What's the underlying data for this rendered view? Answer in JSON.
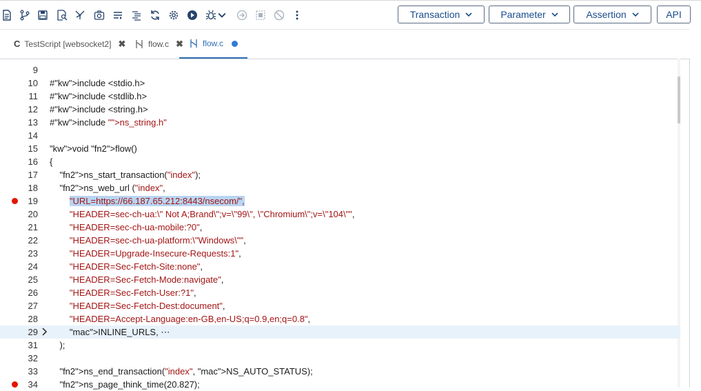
{
  "toolbar": {
    "transaction_label": "Transaction",
    "parameter_label": "Parameter",
    "assertion_label": "Assertion",
    "api_label": "API",
    "icons": [
      "document-icon",
      "branch-icon",
      "save-icon",
      "search-doc-icon",
      "network-icon",
      "camera-icon",
      "list-icon",
      "list-indent-icon",
      "refresh-icon",
      "gear-icon",
      "play-icon",
      "debug-icon",
      "forward-icon",
      "screen-icon",
      "block-icon",
      "more-icon"
    ]
  },
  "tabs": [
    {
      "label": "TestScript [websocket2]",
      "icon": "c-icon",
      "close": "✖"
    },
    {
      "label": "flow.c",
      "icon": "flow-icon",
      "close": "✖"
    },
    {
      "label": "flow.c",
      "icon": "flow-icon",
      "modified": true
    }
  ],
  "editor": {
    "lines": [
      {
        "n": "9",
        "code": ""
      },
      {
        "n": "10",
        "code": "#include <stdio.h>"
      },
      {
        "n": "11",
        "code": "#include <stdlib.h>"
      },
      {
        "n": "12",
        "code": "#include <string.h>"
      },
      {
        "n": "13",
        "code": "#include \"ns_string.h\""
      },
      {
        "n": "14",
        "code": ""
      },
      {
        "n": "15",
        "code": "void flow()"
      },
      {
        "n": "16",
        "code": "{"
      },
      {
        "n": "17",
        "code": "    ns_start_transaction(\"index\");"
      },
      {
        "n": "18",
        "code": "    ns_web_url (\"index\","
      },
      {
        "n": "19",
        "code": "        \"URL=https://66.187.65.212:8443/nsecom/\","
      },
      {
        "n": "20",
        "code": "        \"HEADER=sec-ch-ua:\\\" Not A;Brand\\\";v=\\\"99\\\", \\\"Chromium\\\";v=\\\"104\\\"\","
      },
      {
        "n": "21",
        "code": "        \"HEADER=sec-ch-ua-mobile:?0\","
      },
      {
        "n": "22",
        "code": "        \"HEADER=sec-ch-ua-platform:\\\"Windows\\\"\","
      },
      {
        "n": "23",
        "code": "        \"HEADER=Upgrade-Insecure-Requests:1\","
      },
      {
        "n": "24",
        "code": "        \"HEADER=Sec-Fetch-Site:none\","
      },
      {
        "n": "25",
        "code": "        \"HEADER=Sec-Fetch-Mode:navigate\","
      },
      {
        "n": "26",
        "code": "        \"HEADER=Sec-Fetch-User:?1\","
      },
      {
        "n": "27",
        "code": "        \"HEADER=Sec-Fetch-Dest:document\","
      },
      {
        "n": "28",
        "code": "        \"HEADER=Accept-Language:en-GB,en-US;q=0.9,en;q=0.8\","
      },
      {
        "n": "29",
        "code": "        INLINE_URLS, ⋯"
      },
      {
        "n": "31",
        "code": "    );"
      },
      {
        "n": "32",
        "code": ""
      },
      {
        "n": "33",
        "code": "    ns_end_transaction(\"index\", NS_AUTO_STATUS);"
      },
      {
        "n": "34",
        "code": "    ns_page_think_time(20.827);"
      }
    ],
    "breakpoint_lines": [
      "19",
      "34"
    ],
    "folded_line": "29",
    "selected_line": "19"
  },
  "colors": {
    "accent": "#2f6fb3",
    "breakpoint": "#e51400",
    "selection": "#b8d5f2",
    "current_line": "#e8f2fb"
  }
}
